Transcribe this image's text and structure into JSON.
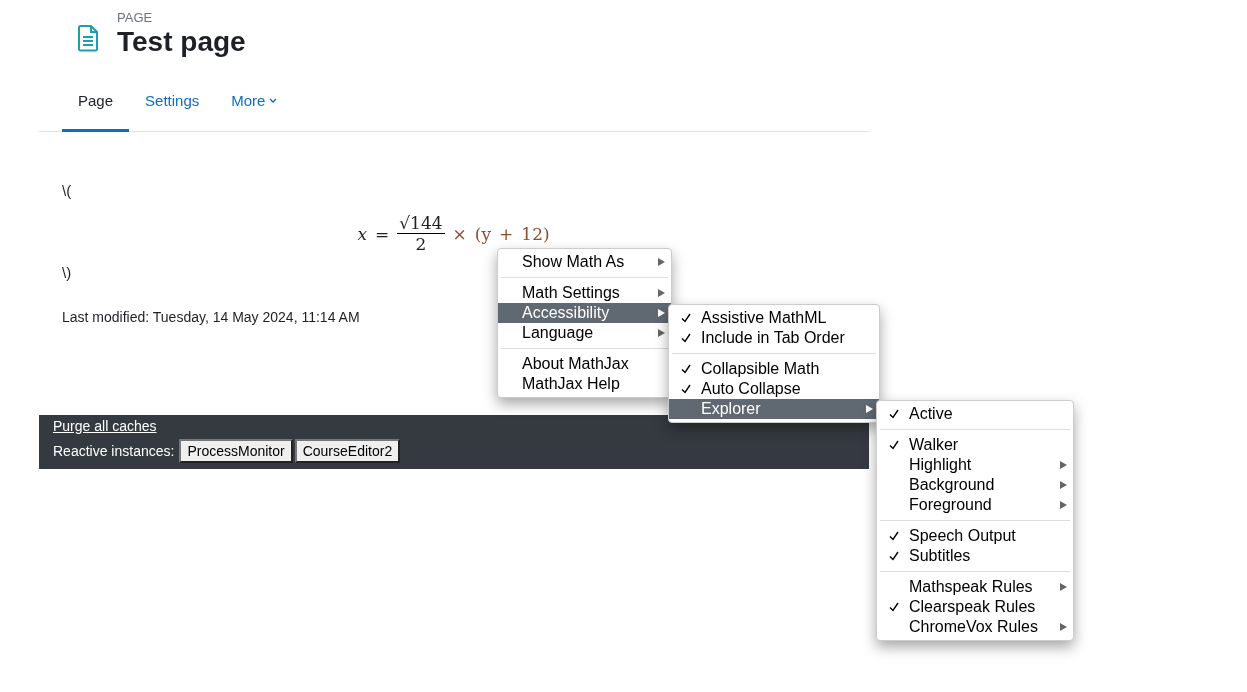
{
  "header": {
    "kicker": "PAGE",
    "title": "Test page"
  },
  "tabs": [
    {
      "label": "Page",
      "selected": true
    },
    {
      "label": "Settings",
      "selected": false
    },
    {
      "label": "More",
      "selected": false,
      "dropdown": true
    }
  ],
  "content": {
    "open_delim": "\\(",
    "formula": {
      "lhs": "x",
      "eq": "=",
      "radical": "√",
      "numerator": "144",
      "denominator": "2",
      "times": "×",
      "rhs_open": "(y",
      "plus": "+",
      "rhs_close": "12)"
    },
    "close_delim": "\\)",
    "last_modified": "Last modified: Tuesday, 14 May 2024, 11:14 AM"
  },
  "footer": {
    "link": "Purge all caches",
    "label": "Reactive instances:",
    "buttons": [
      "ProcessMonitor",
      "CourseEditor2"
    ]
  },
  "menus": [
    {
      "groups": [
        [
          {
            "label": "Show Math As",
            "submenu": true,
            "selected": false
          }
        ],
        [
          {
            "label": "Math Settings",
            "submenu": true,
            "selected": false
          },
          {
            "label": "Accessibility",
            "submenu": true,
            "selected": true
          },
          {
            "label": "Language",
            "submenu": true,
            "selected": false
          }
        ],
        [
          {
            "label": "About MathJax",
            "submenu": false,
            "selected": false
          },
          {
            "label": "MathJax Help",
            "submenu": false,
            "selected": false
          }
        ]
      ]
    },
    {
      "groups": [
        [
          {
            "label": "Assistive MathML",
            "checked": true,
            "submenu": false,
            "selected": false
          },
          {
            "label": "Include in Tab Order",
            "checked": true,
            "submenu": false,
            "selected": false
          }
        ],
        [
          {
            "label": "Collapsible Math",
            "checked": true,
            "submenu": false,
            "selected": false
          },
          {
            "label": "Auto Collapse",
            "checked": true,
            "submenu": false,
            "selected": false
          },
          {
            "label": "Explorer",
            "checked": false,
            "submenu": true,
            "selected": true
          }
        ]
      ]
    },
    {
      "groups": [
        [
          {
            "label": "Active",
            "checked": true,
            "submenu": false,
            "selected": false
          }
        ],
        [
          {
            "label": "Walker",
            "checked": true,
            "submenu": false,
            "selected": false
          },
          {
            "label": "Highlight",
            "checked": false,
            "submenu": true,
            "selected": false
          },
          {
            "label": "Background",
            "checked": false,
            "submenu": true,
            "selected": false
          },
          {
            "label": "Foreground",
            "checked": false,
            "submenu": true,
            "selected": false
          }
        ],
        [
          {
            "label": "Speech Output",
            "checked": true,
            "submenu": false,
            "selected": false
          },
          {
            "label": "Subtitles",
            "checked": true,
            "submenu": false,
            "selected": false
          }
        ],
        [
          {
            "label": "Mathspeak Rules",
            "checked": false,
            "submenu": true,
            "selected": false
          },
          {
            "label": "Clearspeak Rules",
            "checked": true,
            "submenu": false,
            "selected": false
          },
          {
            "label": "ChromeVox Rules",
            "checked": false,
            "submenu": true,
            "selected": false
          }
        ]
      ]
    }
  ]
}
